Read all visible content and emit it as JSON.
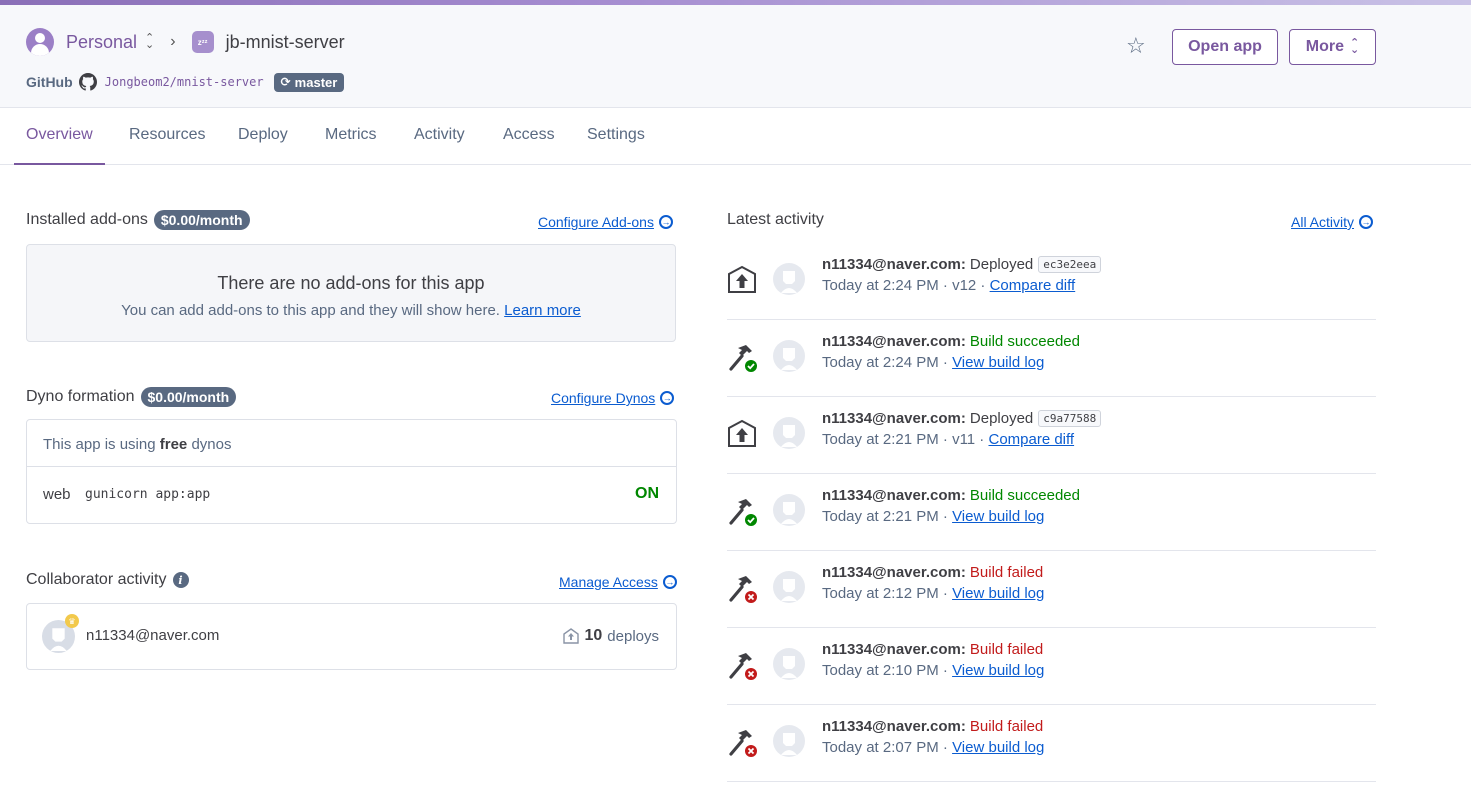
{
  "header": {
    "account": "Personal",
    "app_icon_text": "zᶻᶻ",
    "app_name": "jb-mnist-server",
    "github_label": "GitHub",
    "repo": "Jongbeom2/mnist-server",
    "branch": "master",
    "open_app": "Open app",
    "more": "More"
  },
  "tabs": [
    "Overview",
    "Resources",
    "Deploy",
    "Metrics",
    "Activity",
    "Access",
    "Settings"
  ],
  "addons": {
    "title": "Installed add-ons",
    "cost": "$0.00/month",
    "configure_link": "Configure Add-ons",
    "empty_title": "There are no add-ons for this app",
    "empty_text": "You can add add-ons to this app and they will show here.",
    "learn_more": "Learn more"
  },
  "dynos": {
    "title": "Dyno formation",
    "cost": "$0.00/month",
    "configure_link": "Configure Dynos",
    "using_prefix": "This app is using",
    "using_type": "free",
    "using_suffix": "dynos",
    "dyno_type": "web",
    "command": "gunicorn app:app",
    "status": "ON"
  },
  "collaborators": {
    "title": "Collaborator activity",
    "manage_link": "Manage Access",
    "email": "n11334@naver.com",
    "deploy_count": "10",
    "deploy_label": "deploys"
  },
  "activity": {
    "title": "Latest activity",
    "all_link": "All Activity",
    "items": [
      {
        "kind": "deploy",
        "user": "n11334@naver.com:",
        "action": "Deployed",
        "sha": "ec3e2eea",
        "time": "Today at 2:24 PM · v12 ·",
        "link": "Compare diff"
      },
      {
        "kind": "build-ok",
        "user": "n11334@naver.com:",
        "action": "Build succeeded",
        "sha": "",
        "time": "Today at 2:24 PM ·",
        "link": "View build log"
      },
      {
        "kind": "deploy",
        "user": "n11334@naver.com:",
        "action": "Deployed",
        "sha": "c9a77588",
        "time": "Today at 2:21 PM · v11 ·",
        "link": "Compare diff"
      },
      {
        "kind": "build-ok",
        "user": "n11334@naver.com:",
        "action": "Build succeeded",
        "sha": "",
        "time": "Today at 2:21 PM ·",
        "link": "View build log"
      },
      {
        "kind": "build-fail",
        "user": "n11334@naver.com:",
        "action": "Build failed",
        "sha": "",
        "time": "Today at 2:12 PM ·",
        "link": "View build log"
      },
      {
        "kind": "build-fail",
        "user": "n11334@naver.com:",
        "action": "Build failed",
        "sha": "",
        "time": "Today at 2:10 PM ·",
        "link": "View build log"
      },
      {
        "kind": "build-fail",
        "user": "n11334@naver.com:",
        "action": "Build failed",
        "sha": "",
        "time": "Today at 2:07 PM ·",
        "link": "View build log"
      }
    ]
  },
  "colors": {
    "brand": "#79589f",
    "link": "#0b5cd0",
    "success": "#008700",
    "failure": "#c21b1b",
    "badge": "#596981"
  }
}
